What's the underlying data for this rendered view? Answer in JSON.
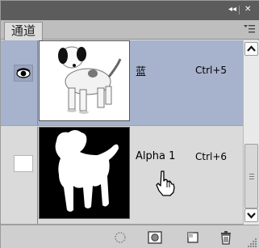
{
  "window": {
    "collapse_glyph": "◂◂",
    "close_glyph": "✕"
  },
  "tab": {
    "label": "通道"
  },
  "channels": [
    {
      "name": "蓝",
      "shortcut": "Ctrl+5",
      "visible": true,
      "selected": true
    },
    {
      "name": "Alpha 1",
      "shortcut": "Ctrl+6",
      "visible": false,
      "selected": false
    }
  ],
  "icons": {
    "eye": "eye-icon",
    "panel_menu": "panel-menu-icon",
    "load_selection": "dotted-circle-icon",
    "save_selection": "mask-icon",
    "new_channel": "new-channel-icon",
    "delete_channel": "trash-icon",
    "cursor": "hand-cursor-icon"
  },
  "colors": {
    "selected_row": "#a7b3cc",
    "panel_bg": "#dcdcdc",
    "title_strip": "#5c5c5c"
  }
}
